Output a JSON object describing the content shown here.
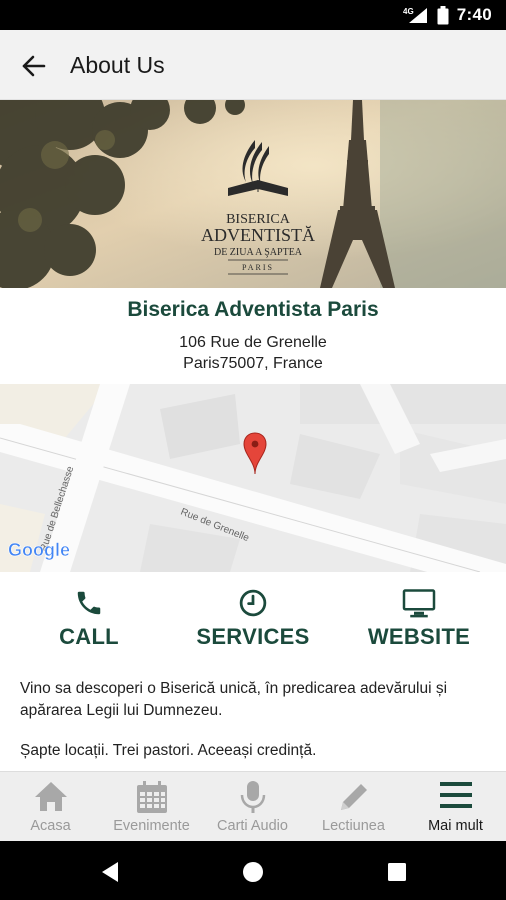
{
  "status_bar": {
    "network": "4G",
    "time": "7:40",
    "icons": [
      "signal-icon",
      "battery-icon"
    ]
  },
  "app_bar": {
    "back_icon": "arrow-left-icon",
    "title": "About Us"
  },
  "banner": {
    "logo_line1": "BISERICA",
    "logo_line2": "ADVENTISTĂ",
    "logo_line3": "DE ZIUA A ŞAPTEA",
    "logo_city": "PARIS"
  },
  "info": {
    "name": "Biserica Adventista Paris",
    "address_line1": "106 Rue de Grenelle",
    "address_line2": "Paris75007, France"
  },
  "map": {
    "street_main": "Rue de Grenelle",
    "street_side": "Rue de Bellechasse",
    "attribution": "Google",
    "pin_color": "#e5453a"
  },
  "actions": [
    {
      "icon": "phone-icon",
      "label": "CALL"
    },
    {
      "icon": "clock-icon",
      "label": "SERVICES"
    },
    {
      "icon": "monitor-icon",
      "label": "WEBSITE"
    }
  ],
  "description": {
    "paragraph1": "Vino sa descoperi o Biserică unică, în predicarea adevărului și apărarea Legii lui Dumnezeu.",
    "paragraph2": "Șapte locații. Trei pastori. Aceeași credință."
  },
  "bottom_nav": [
    {
      "icon": "home-icon",
      "label": "Acasa",
      "active": false
    },
    {
      "icon": "calendar-icon",
      "label": "Evenimente",
      "active": false
    },
    {
      "icon": "microphone-icon",
      "label": "Carti Audio",
      "active": false
    },
    {
      "icon": "pencil-icon",
      "label": "Lectiunea",
      "active": false
    },
    {
      "icon": "menu-icon",
      "label": "Mai mult",
      "active": true
    }
  ],
  "colors": {
    "accent": "#1b4a3c",
    "app_bar": "#f2f2f2",
    "nav_inactive": "#9a9a9a",
    "nav_active": "#1a1a1a"
  }
}
